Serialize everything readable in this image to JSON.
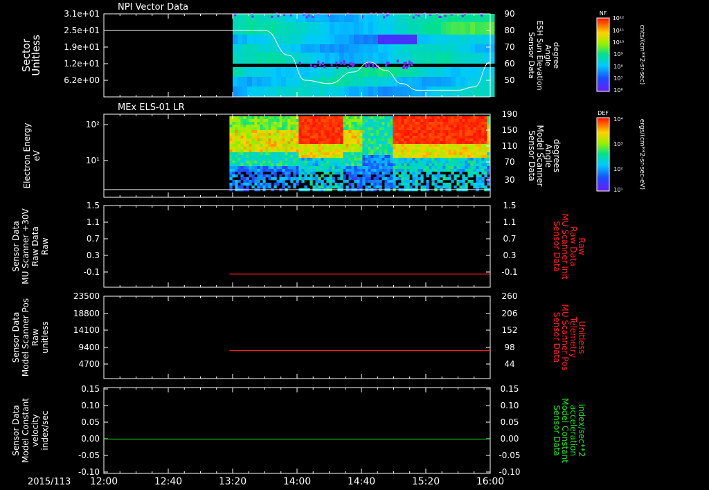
{
  "figure": {
    "date_label": "2015/113",
    "time_ticks": [
      "12:00",
      "12:40",
      "13:20",
      "14:00",
      "14:40",
      "15:20",
      "16:00"
    ]
  },
  "chart_data": [
    {
      "id": "npi",
      "type": "heatmap",
      "title": "NPI Vector Data",
      "ylabel_left": [
        "Sector",
        "Unitless"
      ],
      "ytick_left": [
        "3.1e+01",
        "2.5e+01",
        "1.9e+01",
        "1.2e+01",
        "6.2e+00"
      ],
      "ylabel_right": [
        "Sensor Data",
        "ESH Sun Elevation",
        "Angle",
        "degree"
      ],
      "ytick_right": [
        "90",
        "80",
        "70",
        "60",
        "50"
      ],
      "right_ylim": [
        40,
        90
      ],
      "data_start_time": "13:20",
      "colorbar": {
        "label": "NF",
        "units": "cnts/(cm**2-sr-sec)",
        "ticks": [
          "10¹²",
          "10¹¹",
          "10¹⁰",
          "10⁹",
          "10⁸",
          "10⁷",
          "10⁶"
        ]
      },
      "overlay_line": {
        "name": "ESH Sun Elevation Angle",
        "color": "#ffffff",
        "x": [
          "12:00",
          "13:20",
          "13:40",
          "13:55",
          "14:05",
          "14:20",
          "14:35",
          "14:45",
          "14:55",
          "15:05",
          "15:15",
          "15:25",
          "15:40",
          "15:50",
          "16:00"
        ],
        "y": [
          80,
          80,
          80,
          65,
          50,
          48,
          55,
          61,
          56,
          48,
          44,
          44,
          44,
          46,
          61
        ]
      }
    },
    {
      "id": "els",
      "type": "heatmap",
      "title": "MEx ELS-01 LR",
      "ylabel_left": [
        "Electron Energy",
        "eV"
      ],
      "ytick_left": [
        "10²",
        "10¹"
      ],
      "ylabel_right": [
        "Sensor Data",
        "Model Scanner",
        "Angle",
        "degrees"
      ],
      "ytick_right": [
        "190",
        "150",
        "110",
        "70",
        "30"
      ],
      "data_start_time": "13:18",
      "colorbar": {
        "label": "DEF",
        "units": "ergs/(cm**2-sr-sec-eV)",
        "ticks": [
          "10⁴",
          "10³",
          "10²",
          "10¹"
        ]
      },
      "overlay_line": {
        "name": "Model Scanner Angle",
        "color": "#ffffff",
        "x": [
          "12:00",
          "16:00"
        ],
        "y": [
          10,
          10
        ]
      }
    },
    {
      "id": "mu_v",
      "type": "line",
      "ylabel_left": [
        "Sensor Data",
        "MU Scanner +30V",
        "Raw Data",
        "Raw"
      ],
      "ytick_left": [
        "1.5",
        "1.1",
        "0.7",
        "0.3",
        "-0.1"
      ],
      "ylabel_right": [
        "Sensor Data",
        "MU Scanner Init",
        "Raw Data",
        "Raw"
      ],
      "ytick_right": [
        "1.5",
        "1.1",
        "0.7",
        "0.3",
        "-0.1"
      ],
      "ylim": [
        -0.3,
        1.5
      ],
      "series": [
        {
          "color": "#ff2020",
          "x": [
            "13:18",
            "16:00"
          ],
          "y": [
            -0.01,
            -0.01
          ]
        }
      ]
    },
    {
      "id": "mu_pos",
      "type": "line",
      "ylabel_left": [
        "Sensor Data",
        "Model Scanner Pos",
        "Raw",
        "unitless"
      ],
      "ytick_left": [
        "23500",
        "18800",
        "14100",
        "9400",
        "4700"
      ],
      "ylabel_right": [
        "Sensor Data",
        "MU Scanner Pos",
        "Telemetry",
        "Unitless"
      ],
      "ytick_right": [
        "260",
        "206",
        "152",
        "98",
        "44"
      ],
      "ylim": [
        0,
        23500
      ],
      "series": [
        {
          "color": "#ff2020",
          "x": [
            "13:18",
            "16:00"
          ],
          "y": [
            8000,
            8000
          ]
        }
      ]
    },
    {
      "id": "const",
      "type": "line",
      "ylabel_left": [
        "Sensor Data",
        "Model Constant",
        "velocity",
        "index/sec"
      ],
      "ytick_left": [
        "0.15",
        "0.10",
        "0.05",
        "0.00",
        "-0.05",
        "-0.10"
      ],
      "ylabel_right": [
        "Sensor Data",
        "Model Constant",
        "acceleration",
        "index/sec**2"
      ],
      "ytick_right": [
        "0.15",
        "0.10",
        "0.05",
        "0.00",
        "-0.05",
        "-0.10"
      ],
      "ylim": [
        -0.1,
        0.15
      ],
      "series": [
        {
          "color": "#20e020",
          "x": [
            "12:00",
            "16:00"
          ],
          "y": [
            0.0,
            0.0
          ]
        }
      ]
    }
  ]
}
